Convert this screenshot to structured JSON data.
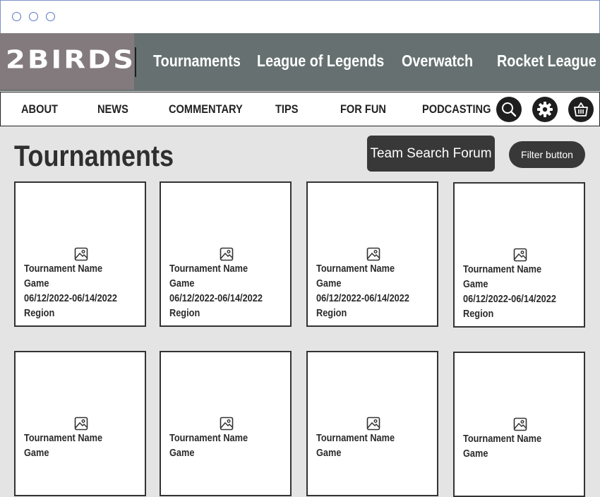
{
  "logo": {
    "text": "2BIRDS"
  },
  "top_nav": [
    "Tournaments",
    "League of Legends",
    "Overwatch",
    "Rocket League"
  ],
  "sub_nav": [
    "ABOUT",
    "NEWS",
    "COMMENTARY",
    "TIPS",
    "FOR FUN",
    "PODCASTING"
  ],
  "icons": {
    "search": "search-icon",
    "settings": "gear-icon",
    "cart": "basket-icon",
    "card_image": "image-placeholder-icon"
  },
  "page": {
    "title": "Tournaments",
    "team_search_label": "Team Search Forum",
    "filter_label": "Filter button"
  },
  "cards": [
    {
      "name": "Tournament Name",
      "game": "Game",
      "dates": "06/12/2022-06/14/2022",
      "region": "Region"
    },
    {
      "name": "Tournament Name",
      "game": "Game",
      "dates": "06/12/2022-06/14/2022",
      "region": "Region"
    },
    {
      "name": "Tournament Name",
      "game": "Game",
      "dates": "06/12/2022-06/14/2022",
      "region": "Region"
    },
    {
      "name": "Tournament Name",
      "game": "Game",
      "dates": "06/12/2022-06/14/2022",
      "region": "Region"
    },
    {
      "name": "Tournament Name",
      "game": "Game"
    },
    {
      "name": "Tournament Name",
      "game": "Game"
    },
    {
      "name": "Tournament Name",
      "game": "Game"
    },
    {
      "name": "Tournament Name",
      "game": "Game"
    }
  ],
  "colors": {
    "header_bg": "#667070",
    "logo_bg": "#837a7d",
    "page_bg": "#e4e4e4",
    "button_bg": "#383838"
  }
}
